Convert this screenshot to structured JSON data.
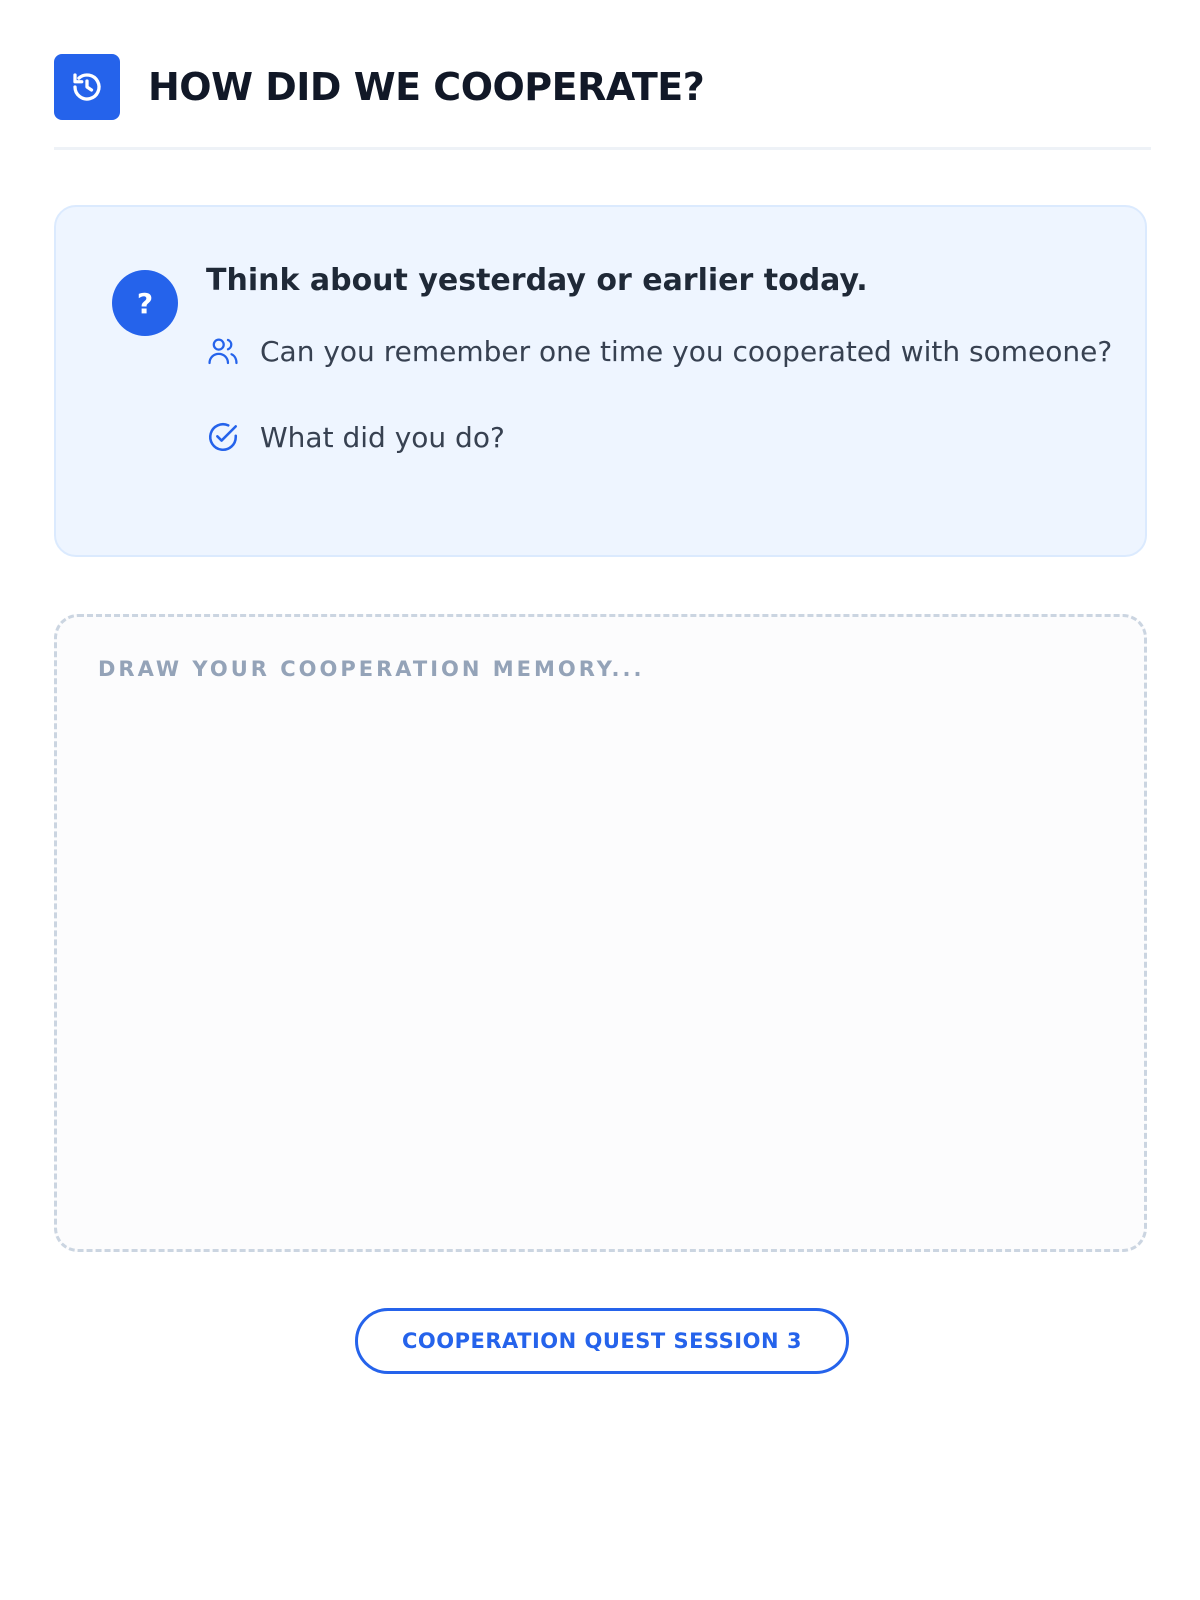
{
  "header": {
    "icon": "history-icon",
    "title": "HOW DID WE COOPERATE?"
  },
  "prompt": {
    "badge_icon": "question-icon",
    "badge_text": "?",
    "heading": "Think about yesterday or earlier today.",
    "items": [
      {
        "icon": "users-icon",
        "text": "Can you remember one time you cooperated with someone?"
      },
      {
        "icon": "check-circle-icon",
        "text": "What did you do?"
      }
    ]
  },
  "drawing": {
    "placeholder": "DRAW YOUR COOPERATION MEMORY..."
  },
  "session": {
    "label": "COOPERATION QUEST SESSION 3"
  },
  "colors": {
    "accent": "#2563eb",
    "card_background": "#eef5ff",
    "title_text": "#111827",
    "placeholder_text": "#94a3b8"
  }
}
